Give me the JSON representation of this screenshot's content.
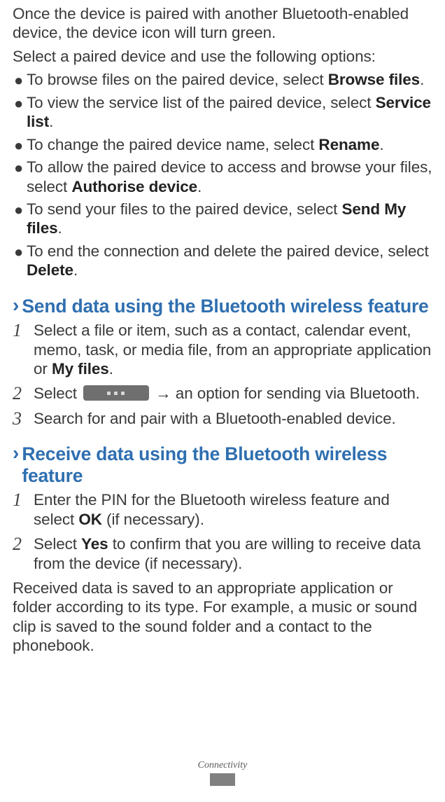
{
  "intro": "Once the device is paired with another Bluetooth-enabled device, the device icon will turn green.",
  "intro2": "Select a paired device and use the following options:",
  "options": [
    {
      "pre": "To browse files on the paired device, select ",
      "bold": "Browse files",
      "post": "."
    },
    {
      "pre": "To view the service list of the paired device, select ",
      "bold": "Service list",
      "post": "."
    },
    {
      "pre": "To change the paired device name, select ",
      "bold": "Rename",
      "post": "."
    },
    {
      "pre": "To allow the paired device to access and browse your files, select ",
      "bold": "Authorise device",
      "post": "."
    },
    {
      "pre": "To send your files to the paired device, select ",
      "bold": "Send My files",
      "post": "."
    },
    {
      "pre": "To end the connection and delete the paired device, select ",
      "bold": "Delete",
      "post": "."
    }
  ],
  "sections": {
    "send": {
      "chevron": "›",
      "title": "Send data using the Bluetooth wireless feature",
      "steps": [
        {
          "pre": "Select a file or item, such as a contact, calendar event, memo, task, or media file, from an appropriate application or ",
          "bold": "My files",
          "post": "."
        },
        {
          "pre": "Select ",
          "has_btn": true,
          "post_btn": " → an option for sending via Bluetooth."
        },
        {
          "pre": "Search for and pair with a Bluetooth-enabled device."
        }
      ]
    },
    "receive": {
      "chevron": "›",
      "title": "Receive data using the Bluetooth wireless feature",
      "steps": [
        {
          "pre": "Enter the PIN for the Bluetooth wireless feature and select ",
          "bold": "OK",
          "post": " (if necessary)."
        },
        {
          "pre": "Select ",
          "bold": "Yes",
          "post": " to confirm that you are willing to receive data from the device (if necessary)."
        }
      ],
      "after": "Received data is saved to an appropriate application or folder according to its type. For example, a music or sound clip is saved to the sound folder and a contact to the phonebook."
    }
  },
  "footer": {
    "label": "Connectivity"
  }
}
